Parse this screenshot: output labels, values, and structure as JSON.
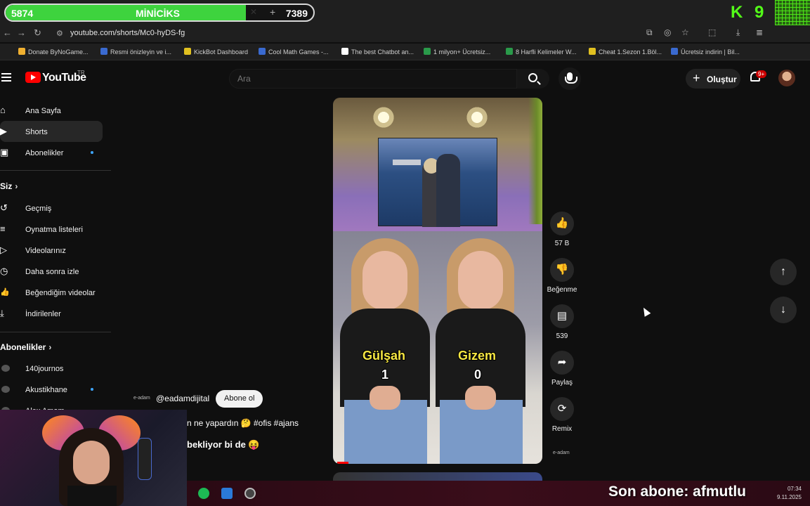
{
  "stream_overlay": {
    "left_count": "5874",
    "title": "MİNİCİKS",
    "right_count": "7389",
    "progress_fraction": 0.78,
    "kick_number": "9",
    "accent": "#53fc18"
  },
  "browser": {
    "url": "youtube.com/shorts/Mc0-hyDS-fg",
    "bookmarks": [
      {
        "label": "Donate ByNoGame...",
        "color": "#f0b030"
      },
      {
        "label": "Resmi önizleyin ve i...",
        "color": "#3a6ad0"
      },
      {
        "label": "KickBot Dashboard",
        "color": "#e0c020"
      },
      {
        "label": "Cool Math Games -...",
        "color": "#3a6ad0"
      },
      {
        "label": "The best Chatbot an...",
        "color": "#ffffff"
      },
      {
        "label": "1 milyon+ Ücretsiz...",
        "color": "#2a9a4a"
      },
      {
        "label": "8 Harfli Kelimeler W...",
        "color": "#2a9a4a"
      },
      {
        "label": "Cheat 1.Sezon 1.Böl...",
        "color": "#e0c020"
      },
      {
        "label": "Ücretsiz indirin | Bil...",
        "color": "#3a6ad0"
      }
    ]
  },
  "header": {
    "logo_text": "YouTube",
    "region": "TR",
    "search_placeholder": "Ara",
    "create_label": "Oluştur",
    "notification_badge": "9+"
  },
  "sidebar": {
    "main": [
      {
        "label": "Ana Sayfa",
        "icon": "home-icon",
        "glyph": "⌂"
      },
      {
        "label": "Shorts",
        "icon": "shorts-icon",
        "glyph": "▶"
      },
      {
        "label": "Abonelikler",
        "icon": "subscriptions-icon",
        "glyph": "▣"
      }
    ],
    "you_heading": "Siz",
    "you": [
      {
        "label": "Geçmiş",
        "icon": "history-icon",
        "glyph": "↺"
      },
      {
        "label": "Oynatma listeleri",
        "icon": "playlists-icon",
        "glyph": "≡"
      },
      {
        "label": "Videolarınız",
        "icon": "your-videos-icon",
        "glyph": "▷"
      },
      {
        "label": "Daha sonra izle",
        "icon": "watch-later-icon",
        "glyph": "◷"
      },
      {
        "label": "Beğendiğim videolar",
        "icon": "liked-videos-icon",
        "glyph": "👍"
      },
      {
        "label": "İndirilenler",
        "icon": "downloads-icon",
        "glyph": "⤓"
      }
    ],
    "subs_heading": "Abonelikler",
    "subs": [
      {
        "label": "140journos"
      },
      {
        "label": "Akustikhane"
      },
      {
        "label": "Alex Amam"
      }
    ]
  },
  "short": {
    "left_name": "Gülşah",
    "left_score": "1",
    "right_name": "Gizem",
    "right_score": "0",
    "channel_logo": "e-adam",
    "channel": "@eadamdijital",
    "subscribe_label": "Abone ol",
    "description_1": "n ne yapardın 🤔 #ofis #ajans",
    "description_2": "bekliyor bi de 😝",
    "watermark": "e-adam"
  },
  "actions": {
    "like_count": "57 B",
    "dislike_label": "Beğenme",
    "comment_count": "539",
    "share_label": "Paylaş",
    "remix_label": "Remix"
  },
  "stream_footer": {
    "last_sub": "Son abone: afmutlu",
    "time": "07:34",
    "date": "9.11.2025"
  }
}
